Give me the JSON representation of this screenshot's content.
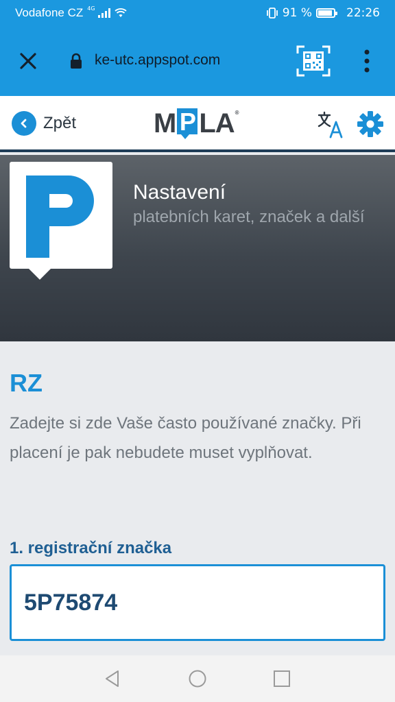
{
  "status_bar": {
    "carrier": "Vodafone CZ",
    "network": "4G",
    "battery_percent": "91 %",
    "battery_level": 0.91,
    "time": "22:26",
    "icons": [
      "signal-icon",
      "wifi-icon",
      "vibrate-icon",
      "battery-icon"
    ]
  },
  "browser": {
    "url": "ke-utc.appspot.com",
    "icons": [
      "close-icon",
      "lock-icon",
      "qr-code-icon",
      "more-vert-icon"
    ]
  },
  "app_header": {
    "back_label": "Zpět",
    "logo_text_before": "M",
    "logo_p": "P",
    "logo_text_after": "LA",
    "logo_registered": "®",
    "icons": [
      "chevron-left-icon",
      "translate-icon",
      "gear-icon"
    ]
  },
  "hero": {
    "tile_letter": "P",
    "title": "Nastavení",
    "subtitle": "platebních karet, značek a další"
  },
  "section": {
    "title": "RZ",
    "description": "Zadejte si zde Vaše často používané značky. Při placení je pak nebudete muset vyplňovat.",
    "field_label": "1. registrační značka",
    "field_value": "5P75874"
  },
  "nav_bar": {
    "icons": [
      "back-triangle-icon",
      "home-circle-icon",
      "recents-square-icon"
    ]
  },
  "colors": {
    "brand_blue": "#1b8fd6",
    "browser_blue": "#1b98df",
    "hero_dark": "#3e454d",
    "label_blue": "#1f5f93"
  }
}
